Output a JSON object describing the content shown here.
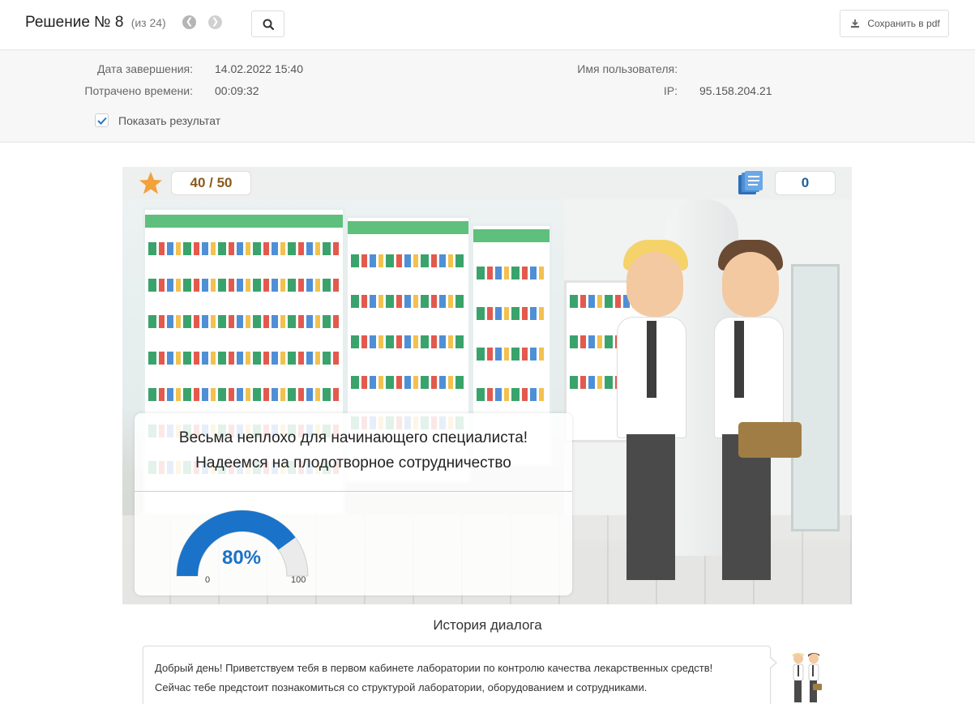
{
  "header": {
    "title": "Решение № 8",
    "of_count": "(из 24)",
    "pdf_label": "Сохранить в pdf"
  },
  "info": {
    "completion_label": "Дата завершения:",
    "completion_value": "14.02.2022 15:40",
    "time_label": "Потрачено времени:",
    "time_value": "00:09:32",
    "user_label": "Имя пользователя:",
    "user_value": "",
    "ip_label": "IP:",
    "ip_value": "95.158.204.21",
    "show_result_label": "Показать результат",
    "show_result_checked": true
  },
  "scene": {
    "score": "40 / 50",
    "count": "0",
    "result_line1": "Весьма неплохо для начинающего специалиста!",
    "result_line2": "Надеемся на плодотворное сотрудничество",
    "gauge_value": "80%",
    "gauge_fraction": 0.8,
    "gauge_min": "0",
    "gauge_max": "100",
    "gauge_color": "#1a73c9"
  },
  "history": {
    "title": "История диалога",
    "messages": [
      {
        "line1": "Добрый день! Приветствуем тебя в первом кабинете лаборатории по контролю качества лекарственных средств!",
        "line2": "Сейчас тебе предстоит познакомиться со структурой лаборатории, оборудованием и сотрудниками."
      }
    ]
  }
}
